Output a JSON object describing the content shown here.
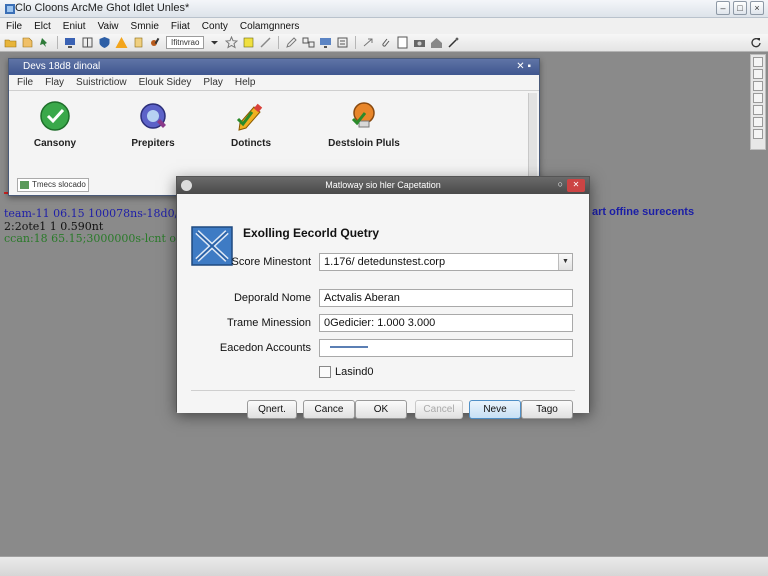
{
  "window": {
    "title": "Clo Cloons ArcMe Ghot Idlet Unles*"
  },
  "menubar": [
    "File",
    "Elct",
    "Eniut",
    "Vaiw",
    "Smnie",
    "Fiiat",
    "Conty",
    "Colamgnners"
  ],
  "toolbar": {
    "combo_label": "Ifitnvrao"
  },
  "bg_window": {
    "title": "Devs 18d8 dinoal",
    "menu": [
      "File",
      "Flay",
      "Suistrictiow",
      "Elouk Sidey",
      "Play",
      "Help"
    ],
    "tools": [
      {
        "label": "Cansony",
        "icon": "check-circle-icon"
      },
      {
        "label": "Prepiters",
        "icon": "gear-globe-icon"
      },
      {
        "label": "Dotincts",
        "icon": "pencil-check-icon"
      },
      {
        "label": "Destsloin Pluls",
        "icon": "bulb-check-icon"
      }
    ],
    "input_text": "Tmecs slocado"
  },
  "log": {
    "line1": "team-11  06.15  100078ns-18d0/0l",
    "line2": "2:2ote1  1  0.590nt",
    "line3": "ccan:18  65.15;3000000s-lcnt of",
    "right_text": "art offine surecents"
  },
  "dialog": {
    "title": "Matloway sio hler Capetation",
    "heading": "Exolling Eecorld Quetry",
    "fields": [
      {
        "label": "Score Minestont",
        "value": "1.176/ detedunstest.corp",
        "kind": "combo"
      },
      {
        "label": "Deporald Nome",
        "value": "Actvalis Aberan",
        "kind": "text"
      },
      {
        "label": "Trame Minession",
        "value": "0Gedicier: 1.000 3.000",
        "kind": "text"
      },
      {
        "label": "Eacedon Accounts",
        "value": "",
        "kind": "slider"
      }
    ],
    "checkbox_label": "Lasind0",
    "buttons": [
      "Qnert.",
      "Cance",
      "OK",
      "Cancel",
      "Neve",
      "Tago"
    ]
  },
  "colors": {
    "dialog_title_bg": "#555555",
    "bg_window_title": "#4a5f96",
    "primary_button": "#c7e0f5",
    "log_blue": "#1f1fa8",
    "log_green": "#2a7a2a"
  }
}
